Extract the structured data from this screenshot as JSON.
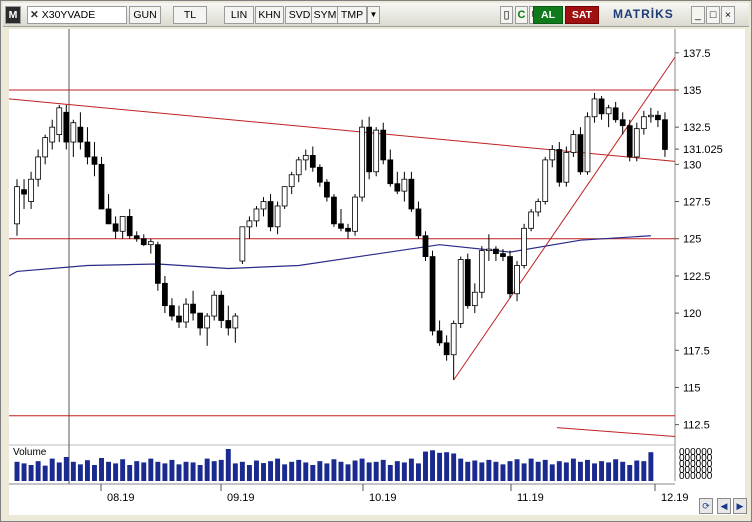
{
  "toolbar": {
    "menu_letter": "M",
    "symbol": "X30YVADE",
    "period": "GUN",
    "currency": "TL",
    "buttons": [
      "LIN",
      "KHN",
      "SVD",
      "SYM",
      "TMP"
    ],
    "dropdown_arrow": "▼",
    "icon_names": [
      "menu-letter-icon",
      "close-x-icon",
      "refresh-icon",
      "copy-icon",
      "twitter-icon",
      "page-icon",
      "checkbox-icon",
      "chart-icon"
    ],
    "buy_label": "AL",
    "sell_label": "SAT",
    "brand": "MATRİKS",
    "win_buttons": [
      "_",
      "□",
      "×"
    ]
  },
  "chart_data": {
    "type": "candlestick",
    "symbol": "X30YVADE",
    "y_ticks": [
      137.5,
      135,
      132.5,
      131.025,
      130,
      127.5,
      125,
      122.5,
      120,
      117.5,
      115,
      112.5
    ],
    "ylim": [
      111.4,
      139.1
    ],
    "current_price": 131.025,
    "x_tick_labels": [
      "08.19",
      "09.19",
      "10.19",
      "11.19",
      "12.19"
    ],
    "volume_label": "Volume",
    "horizontal_lines": [
      135,
      125,
      113.1
    ],
    "ohlc": [
      [
        126,
        129,
        125.2,
        128.5
      ],
      [
        128.3,
        129,
        127,
        128
      ],
      [
        127.5,
        129.5,
        127,
        129
      ],
      [
        129,
        131,
        128.5,
        130.5
      ],
      [
        130.5,
        132,
        130,
        131.8
      ],
      [
        131.5,
        133,
        131,
        132.5
      ],
      [
        132,
        134,
        131.5,
        133.8
      ],
      [
        133.5,
        134,
        131,
        131.5
      ],
      [
        131.5,
        133,
        130.5,
        132.8
      ],
      [
        132.5,
        133.5,
        131,
        131.5
      ],
      [
        131.5,
        132.5,
        130,
        130.5
      ],
      [
        130.5,
        131.5,
        129.2,
        130
      ],
      [
        130,
        130.5,
        127,
        127
      ],
      [
        127,
        128,
        126,
        126
      ],
      [
        126,
        126.5,
        125,
        125.5
      ],
      [
        125.5,
        126.5,
        125,
        126.5
      ],
      [
        126.5,
        127,
        125,
        125.2
      ],
      [
        125.2,
        125.5,
        124.8,
        125
      ],
      [
        125,
        125.3,
        124.5,
        124.6
      ],
      [
        124.6,
        125,
        124,
        124.8
      ],
      [
        124.6,
        124.8,
        121.5,
        122
      ],
      [
        122,
        122.5,
        120,
        120.5
      ],
      [
        120.5,
        121,
        119.5,
        119.8
      ],
      [
        119.8,
        120.5,
        119,
        119.4
      ],
      [
        119.4,
        121,
        119,
        120.6
      ],
      [
        120.6,
        121.5,
        119.5,
        120
      ],
      [
        120,
        120,
        118.5,
        119
      ],
      [
        119,
        120,
        117.8,
        119.8
      ],
      [
        119.8,
        121.5,
        119.5,
        121.2
      ],
      [
        121.2,
        121.5,
        119,
        119.5
      ],
      [
        119.5,
        120.5,
        118.5,
        119
      ],
      [
        119,
        120,
        118,
        119.8
      ],
      [
        123.5,
        125.8,
        123.3,
        125.8
      ],
      [
        125.8,
        126.5,
        125,
        126.2
      ],
      [
        126.2,
        127.2,
        125.8,
        127
      ],
      [
        127,
        127.8,
        126.5,
        127.5
      ],
      [
        127.5,
        128,
        125.5,
        125.8
      ],
      [
        125.8,
        127.5,
        125.3,
        127.2
      ],
      [
        127.2,
        128.5,
        127,
        128.5
      ],
      [
        128.5,
        129.5,
        128,
        129.3
      ],
      [
        129.3,
        130.5,
        128.8,
        130.3
      ],
      [
        130.3,
        131,
        129.6,
        130.6
      ],
      [
        130.6,
        131.2,
        129.5,
        129.8
      ],
      [
        129.8,
        130,
        128.5,
        128.8
      ],
      [
        128.8,
        129,
        127.5,
        127.8
      ],
      [
        127.8,
        128,
        125.8,
        126
      ],
      [
        126,
        127,
        125.5,
        125.7
      ],
      [
        125.7,
        126,
        125,
        125.5
      ],
      [
        125.5,
        128,
        125.2,
        127.8
      ],
      [
        127.8,
        133,
        127.5,
        132.5
      ],
      [
        132.5,
        133.2,
        129,
        129.5
      ],
      [
        129.5,
        132.5,
        129.2,
        132.3
      ],
      [
        132.3,
        132.8,
        130,
        130.3
      ],
      [
        130.3,
        131,
        128.5,
        128.7
      ],
      [
        128.7,
        129.5,
        128,
        128.2
      ],
      [
        128.2,
        129.5,
        127.5,
        129
      ],
      [
        129,
        129.5,
        126.8,
        127
      ],
      [
        127,
        127.5,
        125,
        125.2
      ],
      [
        125.2,
        125.5,
        123.5,
        123.8
      ],
      [
        123.8,
        124.2,
        118.5,
        118.8
      ],
      [
        118.8,
        119.5,
        117.8,
        118
      ],
      [
        118,
        118.5,
        116.8,
        117.2
      ],
      [
        117.2,
        119.5,
        115.5,
        119.3
      ],
      [
        119.3,
        123.8,
        119,
        123.6
      ],
      [
        123.6,
        124,
        120.3,
        120.5
      ],
      [
        120.5,
        122,
        120,
        121.4
      ],
      [
        121.4,
        124.5,
        121,
        124.2
      ],
      [
        124.2,
        125.3,
        123.5,
        124.3
      ],
      [
        124.3,
        124.5,
        123.5,
        124
      ],
      [
        124,
        124.3,
        123.5,
        123.8
      ],
      [
        123.8,
        124.2,
        121,
        121.3
      ],
      [
        121.3,
        123.5,
        120.8,
        123.2
      ],
      [
        123.2,
        126,
        123,
        125.7
      ],
      [
        125.7,
        127,
        125.5,
        126.8
      ],
      [
        126.8,
        127.7,
        126.5,
        127.5
      ],
      [
        127.5,
        130.5,
        127.3,
        130.3
      ],
      [
        130.3,
        131.3,
        129.8,
        131
      ],
      [
        131,
        131.5,
        128.5,
        128.8
      ],
      [
        128.8,
        131.2,
        128.5,
        130.8
      ],
      [
        130.8,
        132.3,
        130.5,
        132
      ],
      [
        132,
        132.5,
        129.3,
        129.5
      ],
      [
        129.5,
        133.5,
        129.3,
        133.2
      ],
      [
        133.2,
        134.8,
        132.8,
        134.4
      ],
      [
        134.4,
        134.6,
        133,
        133.4
      ],
      [
        133.4,
        134,
        132.5,
        133.8
      ],
      [
        133.8,
        134.2,
        132.8,
        133
      ],
      [
        133,
        133.5,
        132,
        132.6
      ],
      [
        132.6,
        133,
        130.2,
        130.5
      ],
      [
        130.5,
        132.8,
        130.2,
        132.4
      ],
      [
        132.4,
        133.6,
        132,
        133.2
      ],
      [
        133.2,
        133.8,
        132.8,
        133.3
      ],
      [
        133.3,
        133.6,
        132.5,
        133
      ],
      [
        133,
        133.5,
        130.5,
        131
      ]
    ],
    "moving_average": [
      [
        0,
        122.8
      ],
      [
        10,
        123.2
      ],
      [
        20,
        123.3
      ],
      [
        30,
        123
      ],
      [
        40,
        123.2
      ],
      [
        50,
        123.9
      ],
      [
        60,
        124.6
      ],
      [
        70,
        124.1
      ],
      [
        80,
        124.9
      ],
      [
        90,
        125.2
      ]
    ],
    "volume": [
      0.6,
      0.55,
      0.5,
      0.62,
      0.48,
      0.7,
      0.58,
      0.75,
      0.6,
      0.52,
      0.65,
      0.5,
      0.72,
      0.6,
      0.55,
      0.68,
      0.5,
      0.62,
      0.58,
      0.7,
      0.6,
      0.55,
      0.66,
      0.52,
      0.6,
      0.58,
      0.5,
      0.7,
      0.62,
      0.66,
      1.0,
      0.55,
      0.6,
      0.5,
      0.64,
      0.56,
      0.62,
      0.7,
      0.52,
      0.6,
      0.66,
      0.58,
      0.5,
      0.62,
      0.55,
      0.68,
      0.6,
      0.52,
      0.64,
      0.7,
      0.58,
      0.6,
      0.66,
      0.5,
      0.62,
      0.58,
      0.7,
      0.55,
      0.92,
      0.96,
      0.88,
      0.9,
      0.86,
      0.7,
      0.6,
      0.64,
      0.58,
      0.66,
      0.6,
      0.52,
      0.62,
      0.68,
      0.55,
      0.7,
      0.6,
      0.66,
      0.52,
      0.62,
      0.58,
      0.7,
      0.6,
      0.66,
      0.55,
      0.62,
      0.58,
      0.68,
      0.6,
      0.5,
      0.64,
      0.62,
      0.9
    ]
  }
}
